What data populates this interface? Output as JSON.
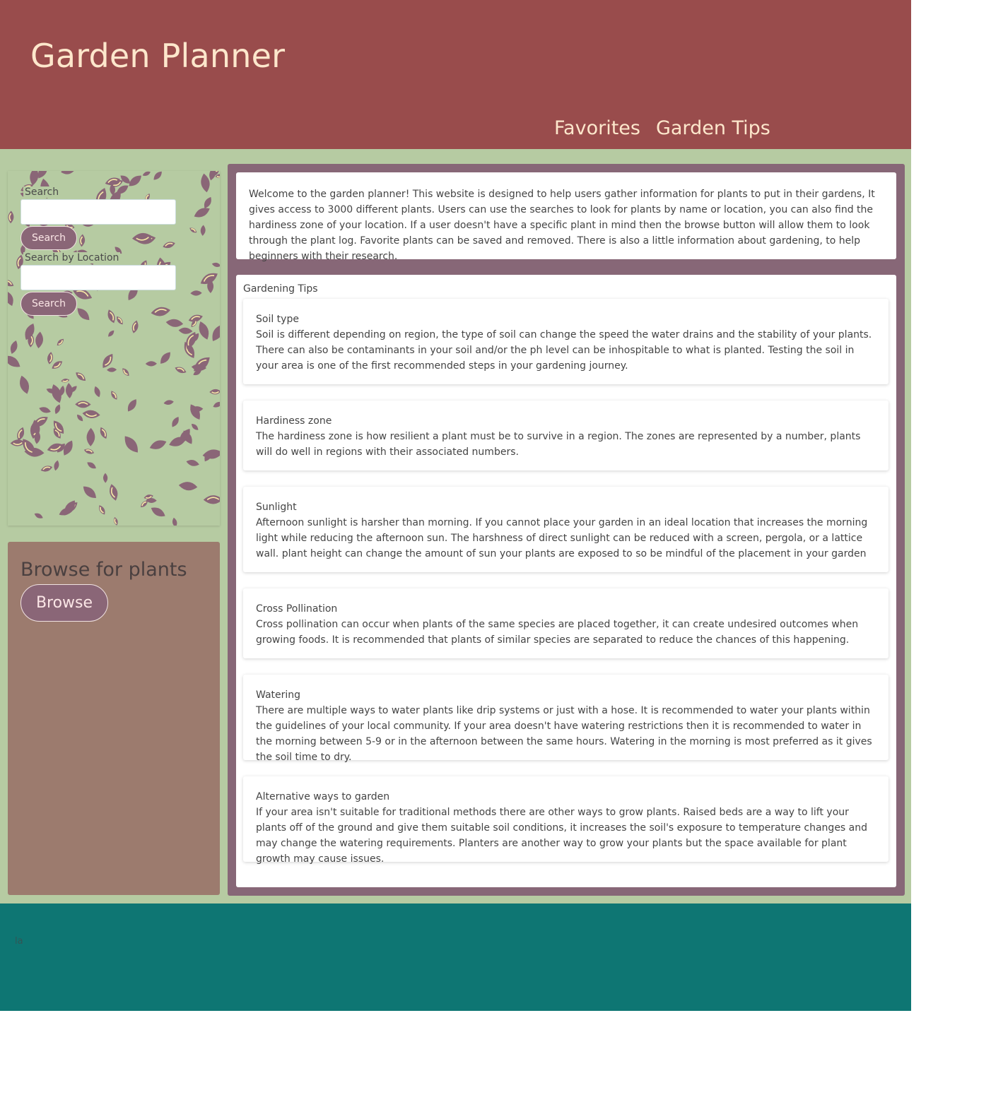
{
  "header": {
    "title": "Garden Planner",
    "nav": [
      "Favorites",
      "Garden Tips"
    ]
  },
  "search": {
    "name_label": "Search",
    "name_button": "Search",
    "location_label": "Search by Location",
    "location_button": "Search"
  },
  "browse": {
    "title": "Browse for plants",
    "button": "Browse"
  },
  "intro": "Welcome to the garden planner! This website is designed to help users gather information for plants to put in their gardens, It gives access to 3000 different plants. Users can use the searches to look for plants by name or location, you can also find the hardiness zone of your location. If a user doesn't have a specific plant in mind then the browse button will allow them to look through the plant log. Favorite plants can be saved and removed. There is also a little information about gardening, to help beginners with their research.",
  "tips": {
    "heading": "Gardening Tips",
    "items": [
      {
        "title": "Soil type",
        "text": "Soil is different depending on region, the type of soil can change the speed the water drains and the stability of your plants. There can also be contaminants in your soil and/or the ph level can be inhospitable to what is planted. Testing the soil in your area is one of the first recommended steps in your gardening journey."
      },
      {
        "title": "Hardiness zone",
        "text": "The hardiness zone is how resilient a plant must be to survive in a region. The zones are represented by a number, plants will do well in regions with their associated numbers."
      },
      {
        "title": "Sunlight",
        "text": "Afternoon sunlight is harsher than morning. If you cannot place your garden in an ideal location that increases the morning light while reducing the afternoon sun. The harshness of direct sunlight can be reduced with a screen, pergola, or a lattice wall. plant height can change the amount of sun your plants are exposed to so be mindful of the placement in your garden"
      },
      {
        "title": "Cross Pollination",
        "text": "Cross pollination can occur when plants of the same species are placed together, it can create undesired outcomes when growing foods. It is recommended that plants of similar species are separated to reduce the chances of this happening."
      },
      {
        "title": "Watering",
        "text": "There are multiple ways to water plants like drip systems or just with a hose. It is recommended to water your plants within the guidelines of your local community. If your area doesn't have watering restrictions then it is recommended to water in the morning between 5-9 or in the afternoon between the same hours. Watering in the morning is most preferred as it gives the soil time to dry."
      },
      {
        "title": "Alternative ways to garden",
        "text": "If your area isn't suitable for traditional methods there are other ways to grow plants. Raised beds are a way to lift your plants off of the ground and give them suitable soil conditions, it increases the soil's exposure to temperature changes and may change the watering requirements. Planters are another way to grow your plants but the space available for plant growth may cause issues."
      }
    ]
  },
  "footer": {
    "text": "la"
  },
  "colors": {
    "header_bg": "#994c4c",
    "header_text": "#fde7cc",
    "main_bg": "#b6cba2",
    "content_frame": "#876777",
    "browse_bg": "#9c7b6e",
    "button_bg": "#8a6677",
    "footer_bg": "#0e7673",
    "leaf_dark": "#8a6677",
    "leaf_light": "#f7eaa6"
  }
}
